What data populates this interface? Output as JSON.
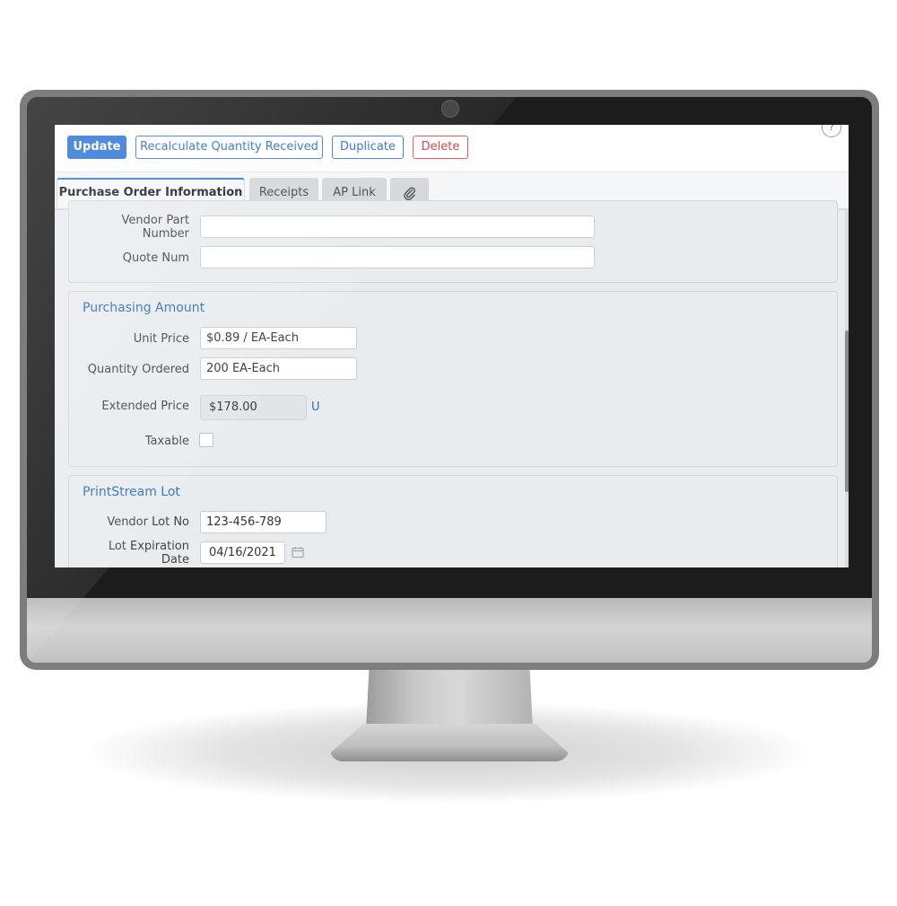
{
  "toolbar": {
    "update_label": "Update",
    "recalc_label": "Recalculate Quantity Received",
    "duplicate_label": "Duplicate",
    "delete_label": "Delete"
  },
  "tabs": [
    {
      "label": "Purchase Order Information",
      "active": true
    },
    {
      "label": "Receipts",
      "active": false
    },
    {
      "label": "AP Link",
      "active": false
    },
    {
      "label": "",
      "icon": "paperclip-icon",
      "active": false
    }
  ],
  "vendor_section": {
    "vendor_part_number_label": "Vendor Part Number",
    "vendor_part_number_value": "",
    "quote_num_label": "Quote Num",
    "quote_num_value": ""
  },
  "purchasing_amount": {
    "title": "Purchasing Amount",
    "unit_price_label": "Unit Price",
    "unit_price_value": "$0.89 / EA-Each",
    "quantity_ordered_label": "Quantity Ordered",
    "quantity_ordered_value": "200 EA-Each",
    "extended_price_label": "Extended Price",
    "extended_price_value": "$178.00",
    "extended_price_link": "U",
    "taxable_label": "Taxable",
    "taxable_checked": false
  },
  "printstream_lot": {
    "title": "PrintStream Lot",
    "vendor_lot_no_label": "Vendor Lot No",
    "vendor_lot_no_value": "123-456-789",
    "lot_expiration_label_line1": "Lot Expiration",
    "lot_expiration_label_line2": "Date",
    "lot_expiration_value": "04/16/2021"
  },
  "colors": {
    "primary": "#2f76d8",
    "danger": "#d93a3a",
    "section_title": "#2f6fc4"
  }
}
